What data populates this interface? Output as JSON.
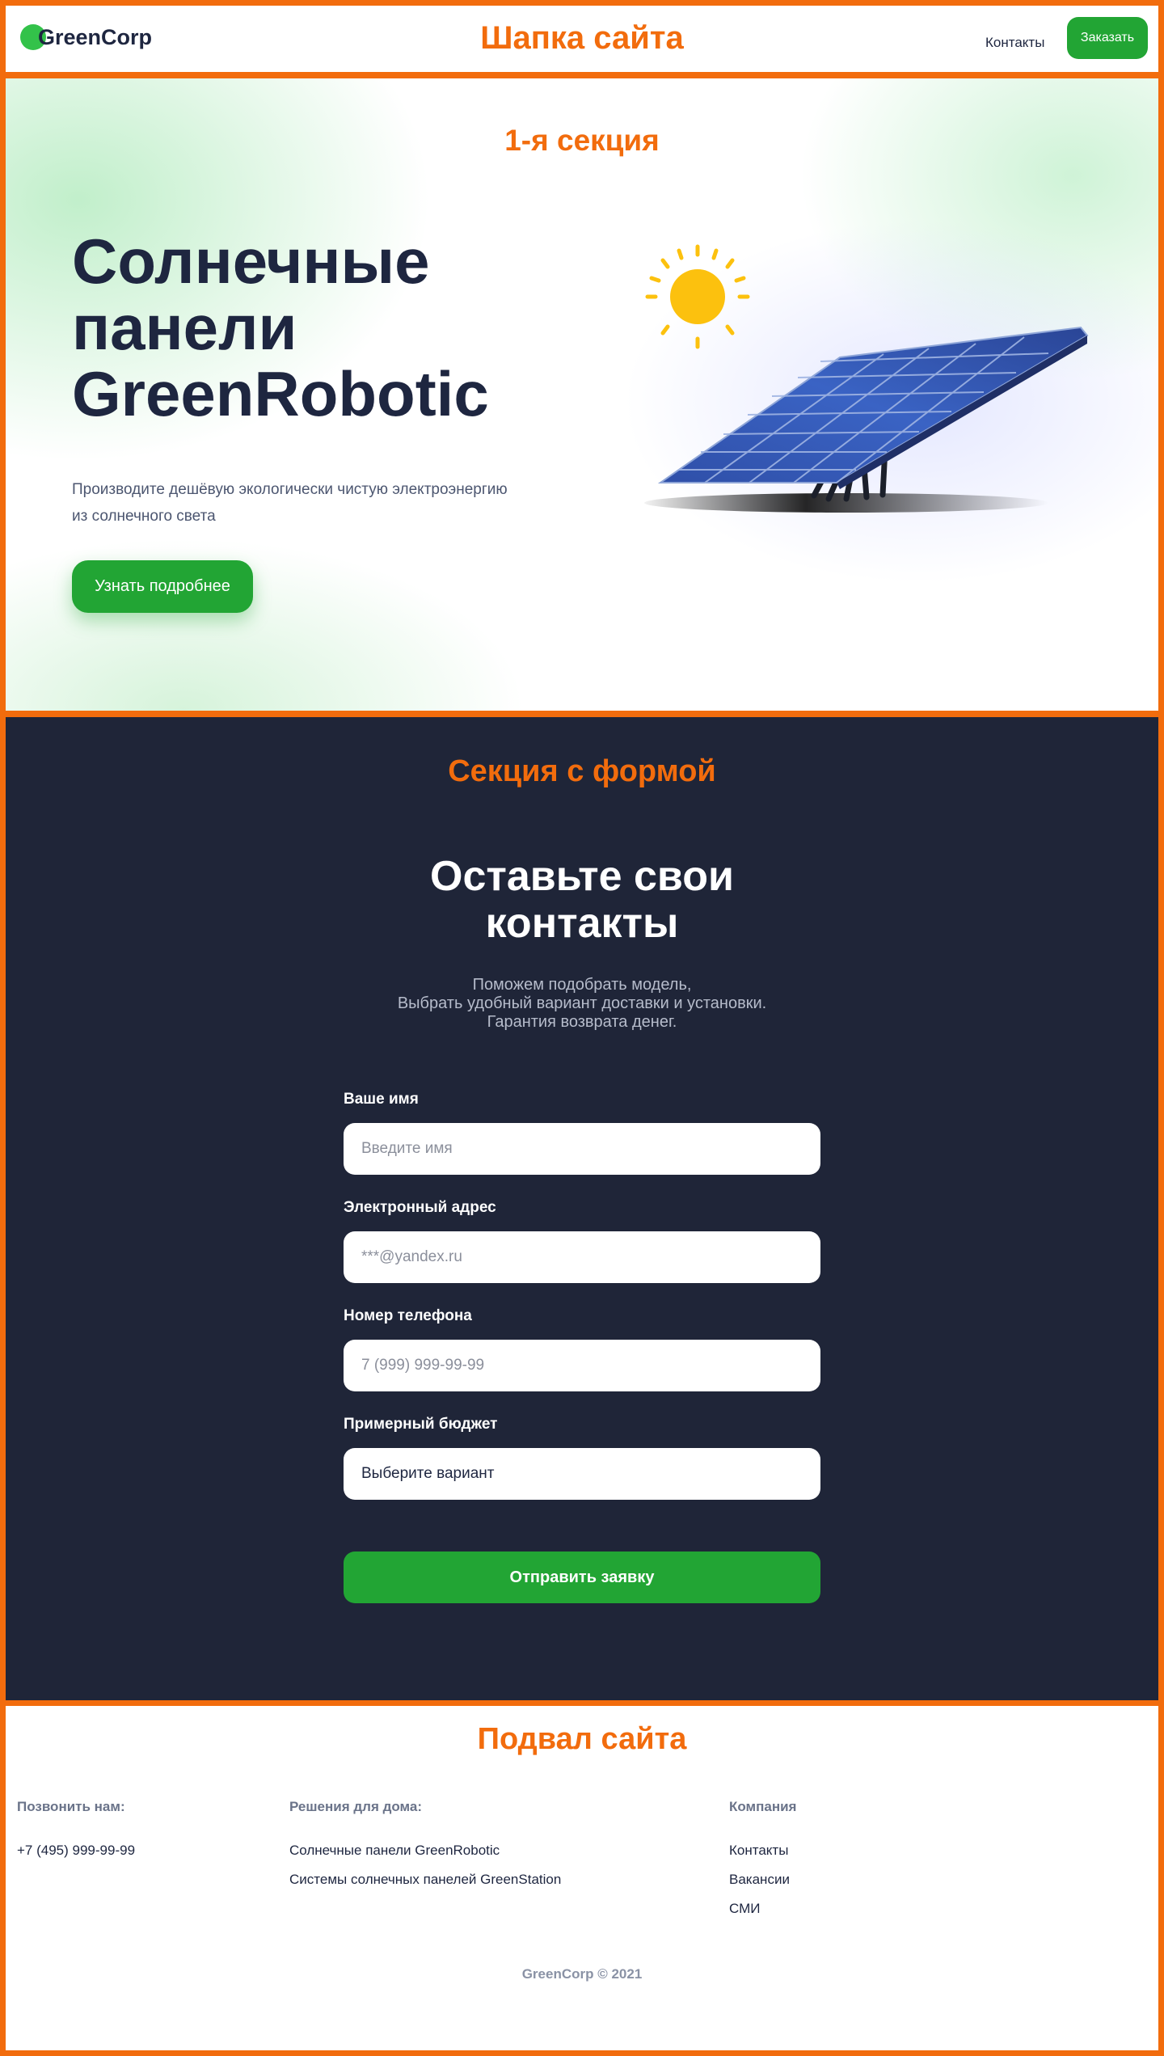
{
  "colors": {
    "accent_orange": "#f26c0d",
    "brand_green": "#22a534",
    "navy": "#1e2640",
    "form_bg": "#1f2538",
    "sun_yellow": "#fcc10e",
    "panel_blue": "#2a4aa3"
  },
  "header": {
    "section_label": "Шапка сайта",
    "logo_text": "GreenCorp",
    "nav_contacts": "Контакты",
    "order_button": "Заказать"
  },
  "hero": {
    "section_label": "1-я секция",
    "title_lines": [
      "Солнечные",
      "панели",
      "GreenRobotic"
    ],
    "subtitle_lines": [
      "Производите дешёвую экологически чистую электроэнергию",
      "из солнечного света"
    ],
    "cta": "Узнать подробнее",
    "art_icons": [
      "sun-icon",
      "solar-panel-illustration"
    ]
  },
  "form": {
    "section_label": "Секция с формой",
    "title_lines": [
      "Оставьте свои",
      "контакты"
    ],
    "subtitle_lines": [
      "Поможем подобрать модель,",
      "Выбрать удобный вариант доставки и установки.",
      "Гарантия возврата денег."
    ],
    "name_label": "Ваше имя",
    "name_placeholder": "Введите имя",
    "email_label": "Электронный адрес",
    "email_placeholder": "***@yandex.ru",
    "phone_label": "Номер телефона",
    "phone_placeholder": "7 (999) 999-99-99",
    "budget_label": "Примерный бюджет",
    "budget_value": "Выберите вариант",
    "submit": "Отправить заявку"
  },
  "footer": {
    "section_label": "Подвал сайта",
    "call_title": "Позвонить нам:",
    "phone": "+7 (495) 999-99-99",
    "home_title": "Решения для дома:",
    "home_links": [
      "Солнечные панели GreenRobotic",
      "Системы солнечных панелей GreenStation"
    ],
    "company_title": "Компания",
    "company_links": [
      "Контакты",
      "Вакансии",
      "СМИ"
    ],
    "copyright": "GreenCorp © 2021"
  }
}
